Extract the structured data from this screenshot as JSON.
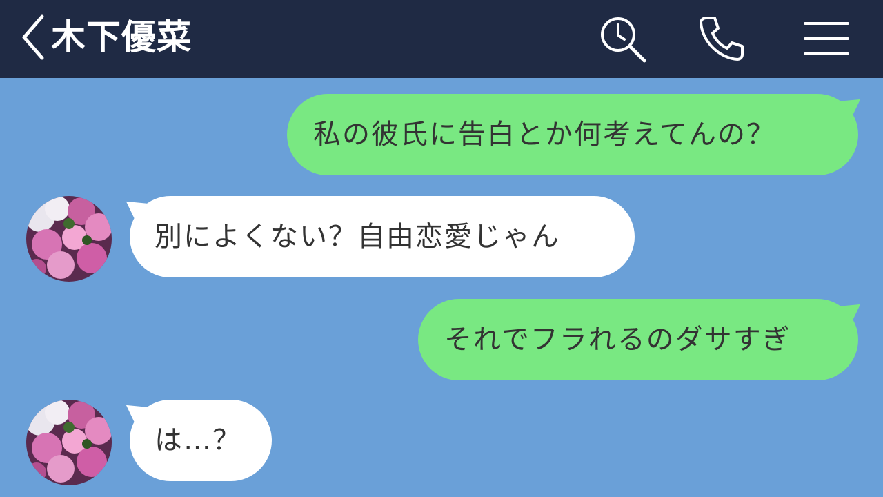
{
  "header": {
    "title": "木下優菜",
    "back_icon": "chevron-left-icon",
    "search_icon": "search-history-icon",
    "call_icon": "phone-icon",
    "menu_icon": "hamburger-menu-icon",
    "background_color": "#1f2a44"
  },
  "chat": {
    "background_color": "#6aa0d8",
    "outgoing_bubble_color": "#79e882",
    "incoming_bubble_color": "#ffffff",
    "messages": [
      {
        "direction": "outgoing",
        "text": "私の彼氏に告白とか何考えてんの？"
      },
      {
        "direction": "incoming",
        "text": "別によくない？自由恋愛じゃん",
        "avatar_icon": "flower-avatar"
      },
      {
        "direction": "outgoing",
        "text": "それでフラれるのダサすぎ"
      },
      {
        "direction": "incoming",
        "text": "は…？",
        "avatar_icon": "flower-avatar"
      }
    ]
  }
}
